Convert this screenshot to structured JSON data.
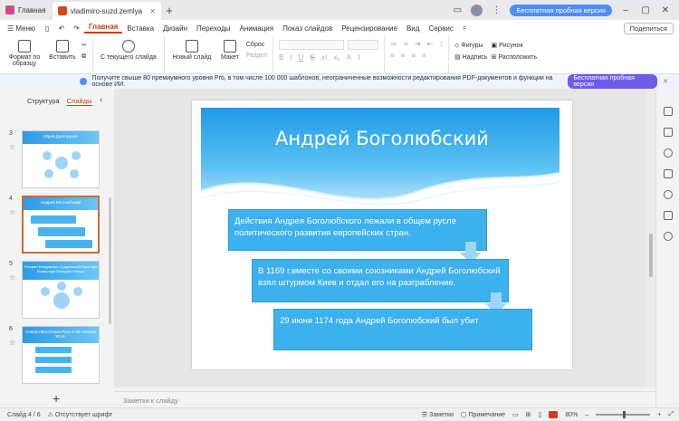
{
  "titlebar": {
    "home_tab": "Главная",
    "doc_tab": "vladimiro-suzd.zemlya",
    "trial_button": "Бесплатная пробная версия"
  },
  "menubar": {
    "menu_label": "Меню",
    "items": [
      "Главная",
      "Вставка",
      "Дизайн",
      "Переходы",
      "Анимация",
      "Показ слайдов",
      "Рецензирование",
      "Вид",
      "Сервис"
    ],
    "active": "Главная",
    "share_label": "Поделиться"
  },
  "ribbon": {
    "format_painter": "Формат по образцу",
    "paste": "Вставить",
    "from_current": "С текущего слайда",
    "new_slide": "Новый слайд",
    "layout": "Макет",
    "reset": "Сброс",
    "section": "Раздел",
    "shapes": "Фигуры",
    "picture": "Рисунок",
    "caption": "Надпись",
    "arrange": "Расположить"
  },
  "banner": {
    "text": "Получите свыше 80 премиумного уровня Pro, в том числе 100 000 шаблонов, неограниченные возможности редактирования PDF-документов и функции на основе ИИ.",
    "button": "Бесплатная пробная версия"
  },
  "left_panel": {
    "tab_structure": "Структура",
    "tab_slides": "Слайды",
    "thumbs": [
      {
        "num": "3",
        "title": "Юрий Долгорукий"
      },
      {
        "num": "4",
        "title": "Андрей Боголюбский"
      },
      {
        "num": "5",
        "title": "Расцвет Владимиро-Суздальской Руси при Всеволоде Большое Гнездо"
      },
      {
        "num": "6",
        "title": "Северо-Восточная Русь в XII–начале XIII в."
      }
    ]
  },
  "slide": {
    "title": "Андрей Боголюбский",
    "block1": "Действия Андрея Боголюбского лежали  в общем русле политического развития европейских стран.",
    "block2": "В 1169 г.вместе со своими союзниками Андрей Боголюбский взял штурмом Киев и отдал его на разграбление.",
    "block3": "29 июня 1174 года Андрей Боголюбский был убит"
  },
  "notes_placeholder": "Заметки к слайду",
  "status": {
    "slide_counter": "Слайд 4 / 6",
    "font_missing": "Отсутствует шрифт",
    "notes_btn": "Заметки",
    "comment_btn": "Примечание",
    "zoom": "80%"
  },
  "colors": {
    "accent": "#c43e1c",
    "slide_blue": "#3db0ee",
    "trial_blue": "#4f8ef7"
  }
}
